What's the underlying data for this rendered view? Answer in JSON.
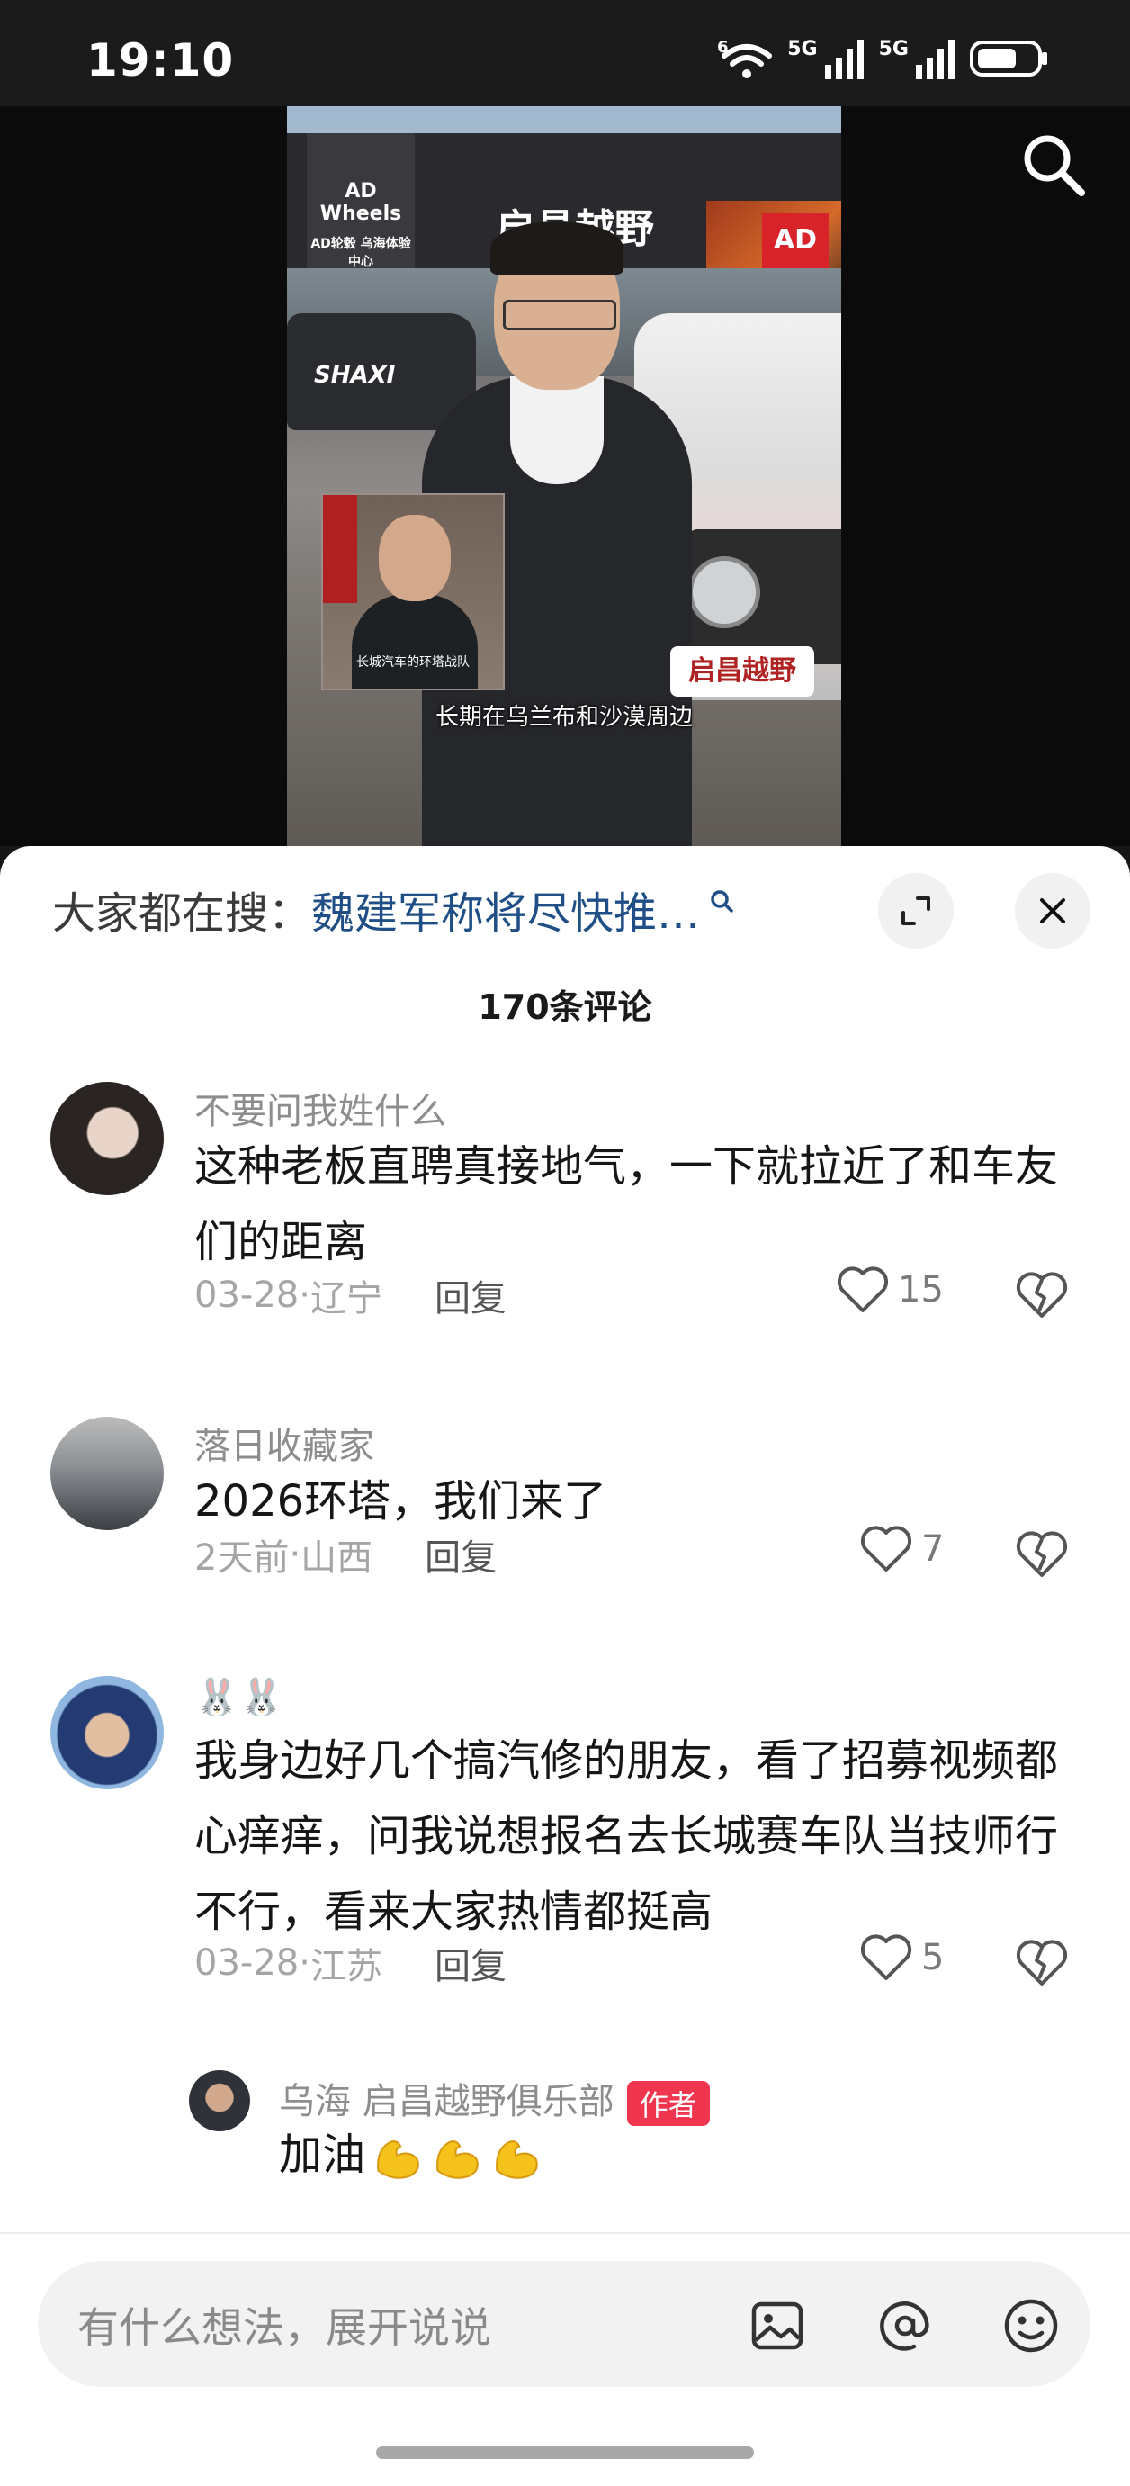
{
  "status_bar": {
    "time": "19:10",
    "net1": "5G",
    "net2": "5G",
    "wifi_label": "6"
  },
  "video": {
    "store_sign": "启昌越野",
    "left_brand": "AD Wheels",
    "left_brand_sub": "AD轮毂 乌海体验中心",
    "truck_text": "SHAXI",
    "plate_text": "启昌越野",
    "pip_caption": "长城汽车的环塔战队",
    "subtitle": "长期在乌兰布和沙漠周边"
  },
  "panel": {
    "hot_search_label": "大家都在搜：",
    "hot_search_query": "魏建军称将尽快推…",
    "comment_count": "170条评论"
  },
  "comments": [
    {
      "user": "不要问我姓什么",
      "text": "这种老板直聘真接地气，一下就拉近了和车友们的距离",
      "date": "03-28",
      "location": "辽宁",
      "reply": "回复",
      "likes": "15"
    },
    {
      "user": "落日收藏家",
      "text": "2026环塔，我们来了",
      "date": "2天前",
      "location": "山西",
      "reply": "回复",
      "likes": "7"
    },
    {
      "user": "🐰🐰",
      "text": "我身边好几个搞汽修的朋友，看了招募视频都心痒痒，问我说想报名去长城赛车队当技师行不行，看来大家热情都挺高",
      "date": "03-28",
      "location": "江苏",
      "reply": "回复",
      "likes": "5"
    }
  ],
  "reply": {
    "user": "乌海 启昌越野俱乐部",
    "tag": "作者",
    "text": "加油"
  },
  "input": {
    "placeholder": "有什么想法，展开说说"
  },
  "meta_sep": " · "
}
